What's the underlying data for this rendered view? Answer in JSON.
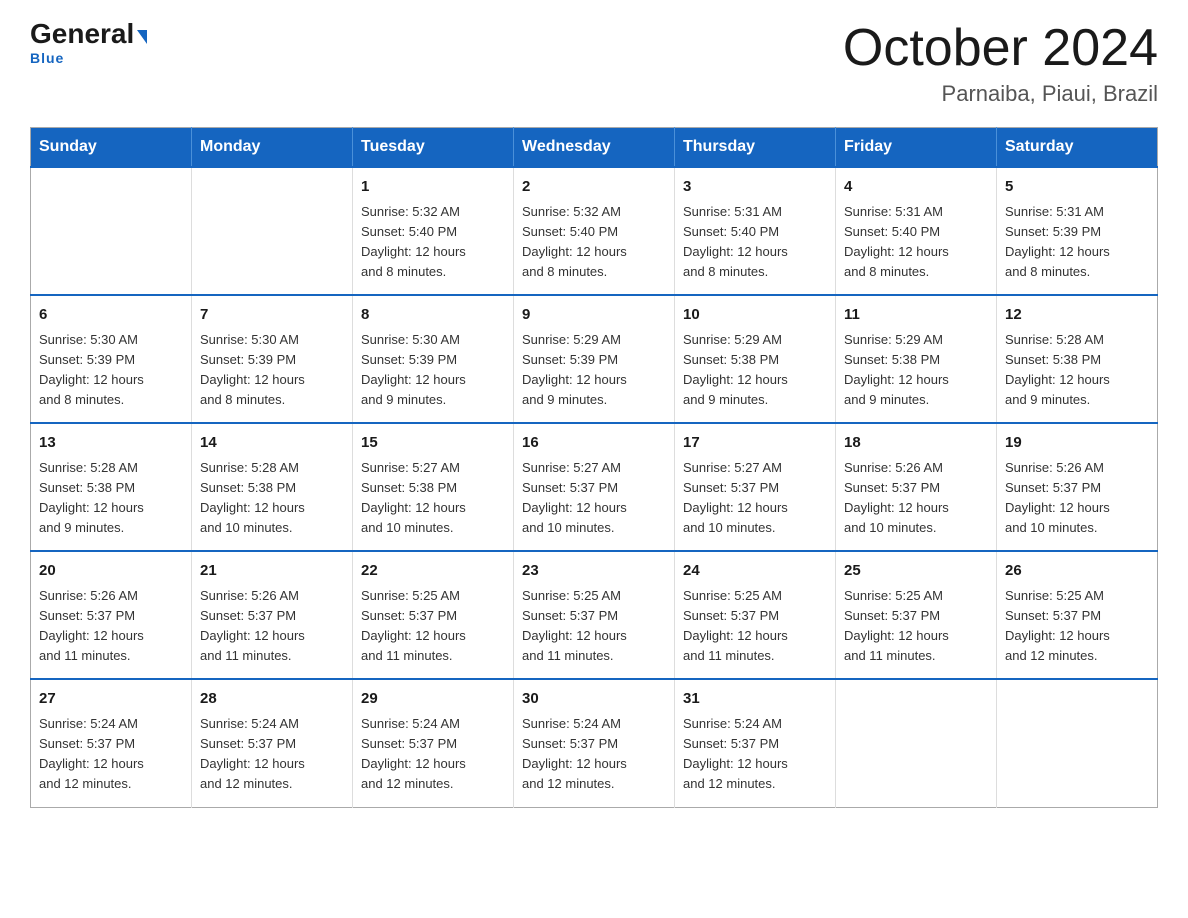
{
  "header": {
    "logo_general": "General",
    "logo_blue": "Blue",
    "month_title": "October 2024",
    "location": "Parnaiba, Piaui, Brazil"
  },
  "weekdays": [
    "Sunday",
    "Monday",
    "Tuesday",
    "Wednesday",
    "Thursday",
    "Friday",
    "Saturday"
  ],
  "weeks": [
    [
      {
        "day": "",
        "info": ""
      },
      {
        "day": "",
        "info": ""
      },
      {
        "day": "1",
        "info": "Sunrise: 5:32 AM\nSunset: 5:40 PM\nDaylight: 12 hours\nand 8 minutes."
      },
      {
        "day": "2",
        "info": "Sunrise: 5:32 AM\nSunset: 5:40 PM\nDaylight: 12 hours\nand 8 minutes."
      },
      {
        "day": "3",
        "info": "Sunrise: 5:31 AM\nSunset: 5:40 PM\nDaylight: 12 hours\nand 8 minutes."
      },
      {
        "day": "4",
        "info": "Sunrise: 5:31 AM\nSunset: 5:40 PM\nDaylight: 12 hours\nand 8 minutes."
      },
      {
        "day": "5",
        "info": "Sunrise: 5:31 AM\nSunset: 5:39 PM\nDaylight: 12 hours\nand 8 minutes."
      }
    ],
    [
      {
        "day": "6",
        "info": "Sunrise: 5:30 AM\nSunset: 5:39 PM\nDaylight: 12 hours\nand 8 minutes."
      },
      {
        "day": "7",
        "info": "Sunrise: 5:30 AM\nSunset: 5:39 PM\nDaylight: 12 hours\nand 8 minutes."
      },
      {
        "day": "8",
        "info": "Sunrise: 5:30 AM\nSunset: 5:39 PM\nDaylight: 12 hours\nand 9 minutes."
      },
      {
        "day": "9",
        "info": "Sunrise: 5:29 AM\nSunset: 5:39 PM\nDaylight: 12 hours\nand 9 minutes."
      },
      {
        "day": "10",
        "info": "Sunrise: 5:29 AM\nSunset: 5:38 PM\nDaylight: 12 hours\nand 9 minutes."
      },
      {
        "day": "11",
        "info": "Sunrise: 5:29 AM\nSunset: 5:38 PM\nDaylight: 12 hours\nand 9 minutes."
      },
      {
        "day": "12",
        "info": "Sunrise: 5:28 AM\nSunset: 5:38 PM\nDaylight: 12 hours\nand 9 minutes."
      }
    ],
    [
      {
        "day": "13",
        "info": "Sunrise: 5:28 AM\nSunset: 5:38 PM\nDaylight: 12 hours\nand 9 minutes."
      },
      {
        "day": "14",
        "info": "Sunrise: 5:28 AM\nSunset: 5:38 PM\nDaylight: 12 hours\nand 10 minutes."
      },
      {
        "day": "15",
        "info": "Sunrise: 5:27 AM\nSunset: 5:38 PM\nDaylight: 12 hours\nand 10 minutes."
      },
      {
        "day": "16",
        "info": "Sunrise: 5:27 AM\nSunset: 5:37 PM\nDaylight: 12 hours\nand 10 minutes."
      },
      {
        "day": "17",
        "info": "Sunrise: 5:27 AM\nSunset: 5:37 PM\nDaylight: 12 hours\nand 10 minutes."
      },
      {
        "day": "18",
        "info": "Sunrise: 5:26 AM\nSunset: 5:37 PM\nDaylight: 12 hours\nand 10 minutes."
      },
      {
        "day": "19",
        "info": "Sunrise: 5:26 AM\nSunset: 5:37 PM\nDaylight: 12 hours\nand 10 minutes."
      }
    ],
    [
      {
        "day": "20",
        "info": "Sunrise: 5:26 AM\nSunset: 5:37 PM\nDaylight: 12 hours\nand 11 minutes."
      },
      {
        "day": "21",
        "info": "Sunrise: 5:26 AM\nSunset: 5:37 PM\nDaylight: 12 hours\nand 11 minutes."
      },
      {
        "day": "22",
        "info": "Sunrise: 5:25 AM\nSunset: 5:37 PM\nDaylight: 12 hours\nand 11 minutes."
      },
      {
        "day": "23",
        "info": "Sunrise: 5:25 AM\nSunset: 5:37 PM\nDaylight: 12 hours\nand 11 minutes."
      },
      {
        "day": "24",
        "info": "Sunrise: 5:25 AM\nSunset: 5:37 PM\nDaylight: 12 hours\nand 11 minutes."
      },
      {
        "day": "25",
        "info": "Sunrise: 5:25 AM\nSunset: 5:37 PM\nDaylight: 12 hours\nand 11 minutes."
      },
      {
        "day": "26",
        "info": "Sunrise: 5:25 AM\nSunset: 5:37 PM\nDaylight: 12 hours\nand 12 minutes."
      }
    ],
    [
      {
        "day": "27",
        "info": "Sunrise: 5:24 AM\nSunset: 5:37 PM\nDaylight: 12 hours\nand 12 minutes."
      },
      {
        "day": "28",
        "info": "Sunrise: 5:24 AM\nSunset: 5:37 PM\nDaylight: 12 hours\nand 12 minutes."
      },
      {
        "day": "29",
        "info": "Sunrise: 5:24 AM\nSunset: 5:37 PM\nDaylight: 12 hours\nand 12 minutes."
      },
      {
        "day": "30",
        "info": "Sunrise: 5:24 AM\nSunset: 5:37 PM\nDaylight: 12 hours\nand 12 minutes."
      },
      {
        "day": "31",
        "info": "Sunrise: 5:24 AM\nSunset: 5:37 PM\nDaylight: 12 hours\nand 12 minutes."
      },
      {
        "day": "",
        "info": ""
      },
      {
        "day": "",
        "info": ""
      }
    ]
  ]
}
